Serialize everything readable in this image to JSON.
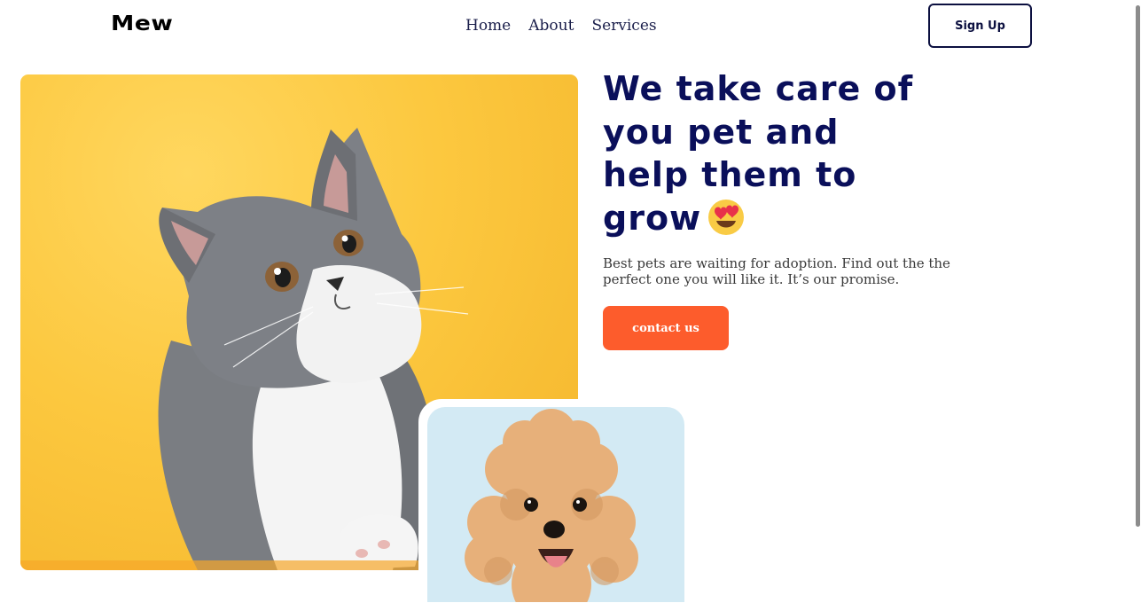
{
  "header": {
    "logo": "Mew",
    "nav": [
      {
        "label": "Home"
      },
      {
        "label": "About"
      },
      {
        "label": "Services"
      }
    ],
    "signup_label": "Sign Up"
  },
  "hero": {
    "headline_lines": [
      "We take care of",
      "you pet and",
      "help them to",
      "grow"
    ],
    "headline_emoji": "smiling-face-with-heart-eyes-icon",
    "description": "Best pets are waiting for adoption. Find out the the perfect one you will like it. It’s our promise.",
    "cta_label": "contact us"
  },
  "images": {
    "primary": "cat-photo",
    "secondary": "dog-photo"
  },
  "colors": {
    "brand_navy": "#0a0f5a",
    "cta_orange": "#fd5c2c",
    "cat_bg": "#fcc83f",
    "dog_bg": "#d3eaf4"
  }
}
